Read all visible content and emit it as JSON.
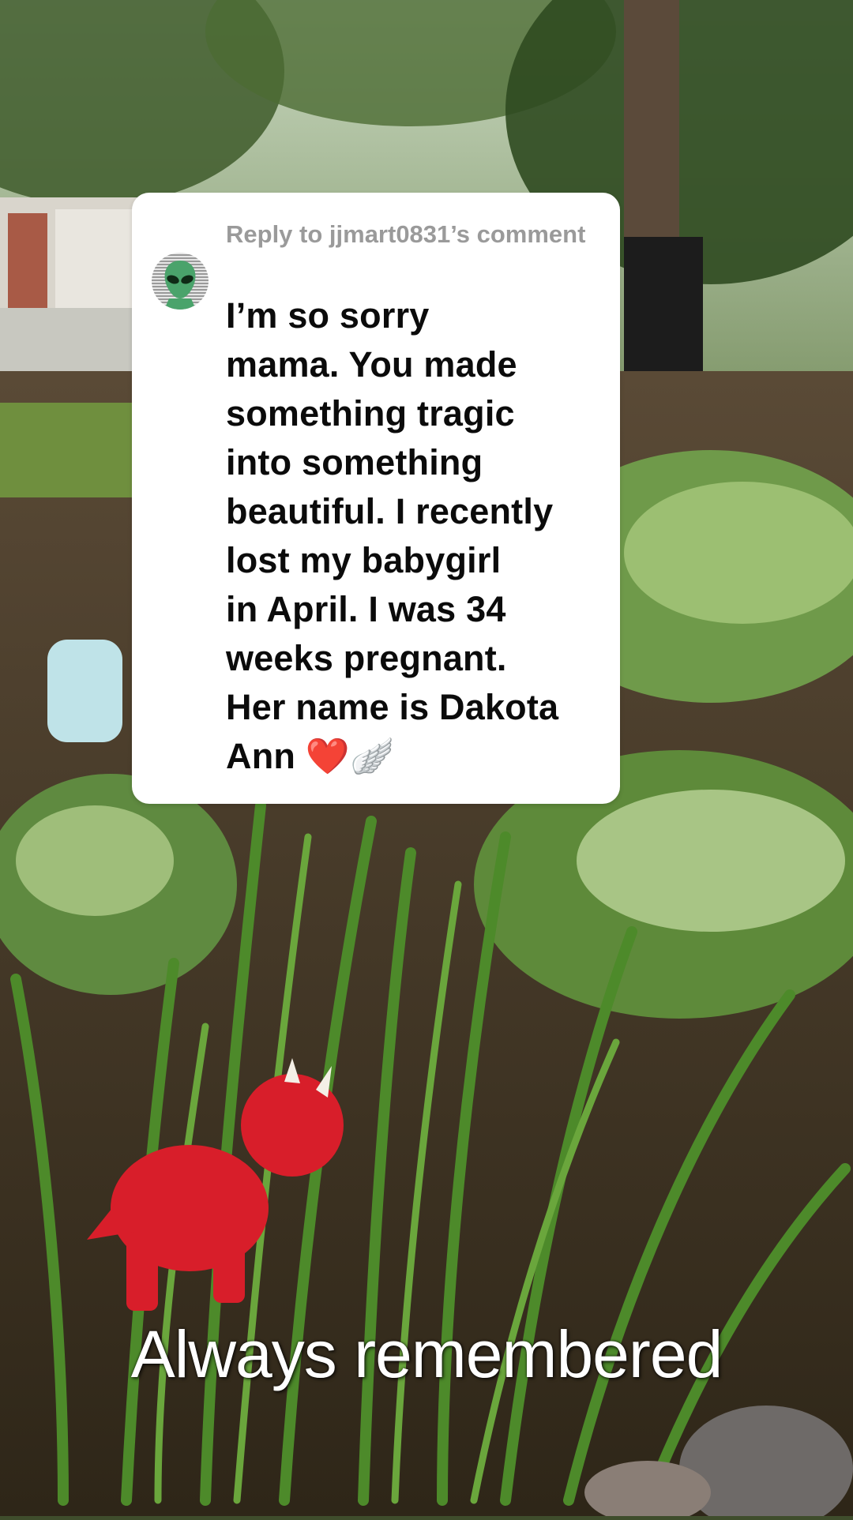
{
  "comment_card": {
    "reply_to": "Reply to jjmart0831’s comment",
    "text": "I’m so sorry\nmama. You made\nsomething tragic\ninto something\nbeautiful. I recently\nlost my babygirl\nin April. I was 34\nweeks pregnant.\nHer name is Dakota\nAnn ❤️🪽",
    "avatar_icon": "alien-avatar-icon"
  },
  "caption": "Always remembered"
}
